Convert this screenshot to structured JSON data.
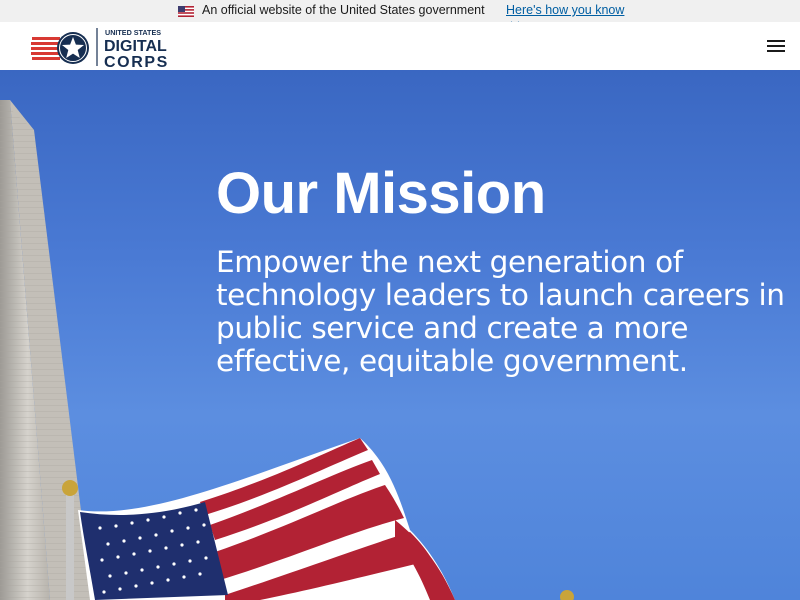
{
  "gov_banner": {
    "text": "An official website of the United States government",
    "link": "Here's how you know",
    "flag_icon": "us-flag-icon",
    "chevron_icon": "chevron-down-icon"
  },
  "header": {
    "logo": {
      "line1": "UNITED STATES",
      "line2": "DIGITAL",
      "line3": "CORPS",
      "icon": "star-stripes-logo"
    },
    "menu_icon": "hamburger-menu-icon"
  },
  "hero": {
    "title": "Our Mission",
    "text": "Empower the next generation of technology leaders to launch careers in public service and create a more effective, equitable government."
  },
  "colors": {
    "banner_bg": "#f0f0f0",
    "link": "#005ea2",
    "brand_navy": "#162e51",
    "brand_red": "#d83933",
    "sky": "#4a7ad4"
  }
}
